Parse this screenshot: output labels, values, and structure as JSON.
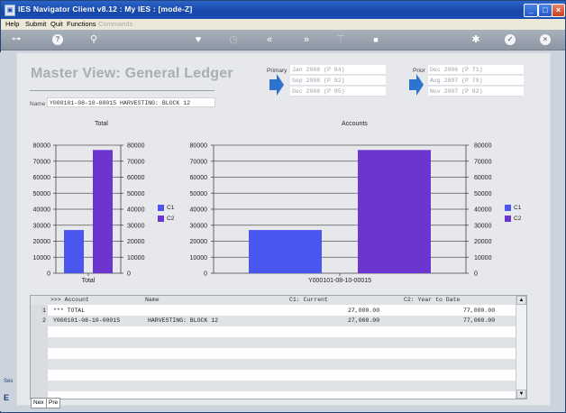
{
  "window": {
    "title": "IES Navigator Client v8.12 : My IES :      [mode-Z]",
    "controls": [
      "_",
      "□",
      "×"
    ]
  },
  "menu": {
    "items": [
      "Help",
      "Submit",
      "Quit",
      "Functions",
      "Commands"
    ],
    "disabled": [
      "Commands"
    ]
  },
  "toolbar": {
    "icons": [
      "key-icon",
      "help-icon",
      "search-icon",
      "heart-icon",
      "clock-icon",
      "rewind-icon",
      "fast-forward-icon",
      "filter-icon",
      "stop-icon",
      "gear-icon",
      "check-icon",
      "close-icon"
    ]
  },
  "header": {
    "title": "Master View: General Ledger",
    "name_label": "Name",
    "name_value": "Y000101-08-10-00015 HARVESTING: BLOCK 12"
  },
  "periods": {
    "primary_label": "Primary",
    "primary": [
      "Jan 2008 (P 84)",
      "Sep 2008 (P 92)",
      "Dec 2008 (P 95)"
    ],
    "prior_label": "Prior",
    "prior": [
      "Dec 2006 (P 71)",
      "Aug 2007 (P 79)",
      "Nov 2007 (P 82)"
    ]
  },
  "colors": {
    "c1": "#4a57ef",
    "c2": "#6d35d0",
    "accent": "#2e73cf"
  },
  "chart_data": [
    {
      "type": "bar",
      "title": "Total",
      "categories": [
        "Total"
      ],
      "series": [
        {
          "name": "C1",
          "values": [
            27000
          ]
        },
        {
          "name": "C2",
          "values": [
            77000
          ]
        }
      ],
      "ylim": [
        0,
        80000
      ],
      "yticks": [
        0,
        10000,
        20000,
        30000,
        40000,
        50000,
        60000,
        70000,
        80000
      ],
      "legend": "right",
      "grid": true
    },
    {
      "type": "bar",
      "title": "Accounts",
      "categories": [
        "Y000101-08-10-00015"
      ],
      "series": [
        {
          "name": "C1",
          "values": [
            27000
          ]
        },
        {
          "name": "C2",
          "values": [
            77000
          ]
        }
      ],
      "ylim": [
        0,
        80000
      ],
      "yticks": [
        0,
        10000,
        20000,
        30000,
        40000,
        50000,
        60000,
        70000,
        80000
      ],
      "legend": "right",
      "grid": true
    }
  ],
  "table": {
    "headers": [
      ">>> Account",
      "Name",
      "C1: Current",
      "C2: Year to Date"
    ],
    "rows": [
      {
        "num": "1",
        "account": "*** TOTAL",
        "name": "",
        "c1": "27,000.00",
        "c2": "77,000.00"
      },
      {
        "num": "2",
        "account": "Y000101-08-10-00015",
        "name": "HARVESTING: BLOCK 12",
        "c1": "27,000.00",
        "c2": "77,000.00"
      }
    ]
  },
  "nav": {
    "next": "Nex",
    "prev": "Pre"
  },
  "side_tabs": [
    "Ses",
    "E"
  ]
}
